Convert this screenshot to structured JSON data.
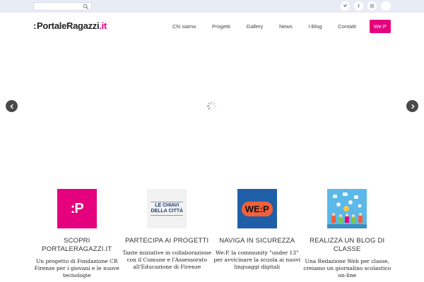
{
  "topbar": {
    "search": {
      "placeholder": "",
      "value": ""
    },
    "socials": [
      "twitter-icon",
      "facebook-icon",
      "instagram-icon",
      "vimeo-icon"
    ]
  },
  "header": {
    "logo": {
      "prefix": ":",
      "name": "PortaleRagazzi",
      "tld": ".it"
    },
    "nav": [
      {
        "label": "Chi siamo"
      },
      {
        "label": "Progetti"
      },
      {
        "label": "Gallery"
      },
      {
        "label": "News"
      },
      {
        "label": "I Blog"
      },
      {
        "label": "Contatti"
      },
      {
        "label": "We:P"
      }
    ]
  },
  "slider": {
    "prev": "prev-arrow-icon",
    "next": "next-arrow-icon",
    "loading": "loading-spinner-icon"
  },
  "features": [
    {
      "image_text": ":P",
      "title": "SCOPRI PORTALERAGAZZI.IT",
      "desc": "Un progetto di Fondazione CR Firenze per i giovani e le nuove tecnologie"
    },
    {
      "image_text": "LE CHIAVI DELLA CITTÀ",
      "title": "PARTECIPA AI PROGETTI",
      "desc": "Tante iniziative in collaborazione con il Comune e l'Assessorato all'Educazione di Firenze"
    },
    {
      "image_text": "WE:P",
      "title": "NAVIGA IN SICUREZZA",
      "desc": "We:P, la community \"under 13\" per avvicinare la scuola ai nuovi linguaggi digitali"
    },
    {
      "image_text": "",
      "title": "REALIZZA UN BLOG DI CLASSE",
      "desc": "Una Redazione Web per classe, creiamo un giornalino scolastico on-line"
    }
  ],
  "colors": {
    "brand": "#e5007e",
    "topbar": "#e8ecf5",
    "arrow": "#4a4a4a",
    "wep_blue": "#1f5fa8",
    "wep_orange": "#f2603a"
  }
}
